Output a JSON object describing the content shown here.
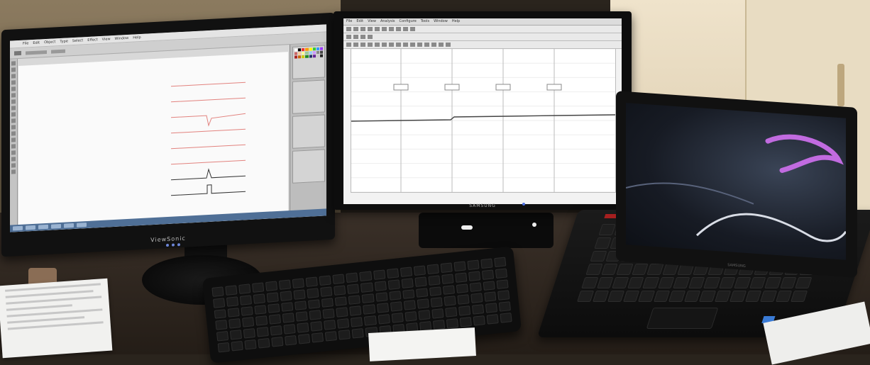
{
  "scene": {
    "left_monitor": {
      "brand": "ViewSonic",
      "app": {
        "menu": [
          "File",
          "Edit",
          "Object",
          "Type",
          "Select",
          "Effect",
          "View",
          "Window",
          "Help"
        ],
        "traces": 8
      }
    },
    "middle_monitor": {
      "brand": "SAMSUNG",
      "app": {
        "menu": [
          "File",
          "Edit",
          "View",
          "Analysis",
          "Configure",
          "Tools",
          "Window",
          "Help"
        ],
        "marker_count": 4
      }
    },
    "laptop": {
      "brand": "SAMSUNG"
    }
  },
  "colors": {
    "trace_red": "#e2827e",
    "trace_black": "#333333",
    "recording_line": "#444444",
    "wallpaper_purple": "#c16be0",
    "led_blue": "#4b6fe0"
  }
}
